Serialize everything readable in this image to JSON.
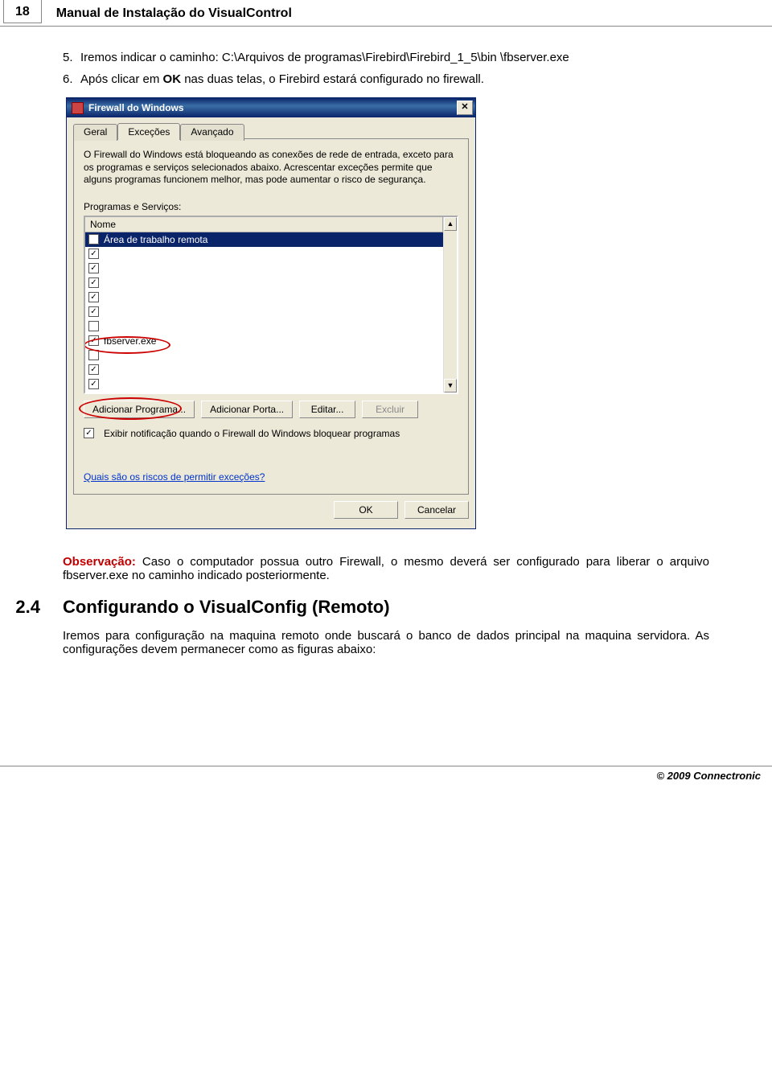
{
  "header": {
    "page_number": "18",
    "title": "Manual de Instalação do VisualControl"
  },
  "steps": [
    {
      "num": "5.",
      "text_a": "Iremos indicar o caminho: C:\\Arquivos de programas\\Firebird\\Firebird_1_5\\bin \\fbserver.exe"
    },
    {
      "num": "6.",
      "text_a": "Após clicar em ",
      "bold": "OK",
      "text_b": " nas duas telas, o Firebird estará configurado no firewall."
    }
  ],
  "dialog": {
    "title": "Firewall do Windows",
    "tabs": {
      "general": "Geral",
      "exceptions": "Exceções",
      "advanced": "Avançado"
    },
    "description": "O Firewall do Windows está bloqueando as conexões de rede de entrada, exceto para os programas e serviços selecionados abaixo. Acrescentar exceções permite que alguns programas funcionem melhor, mas pode aumentar o risco de segurança.",
    "list_label": "Programas e Serviços:",
    "list_header": "Nome",
    "items": [
      {
        "checked": false,
        "label": "Área de trabalho remota",
        "selected": true
      },
      {
        "checked": true,
        "label": ""
      },
      {
        "checked": true,
        "label": ""
      },
      {
        "checked": true,
        "label": ""
      },
      {
        "checked": true,
        "label": ""
      },
      {
        "checked": true,
        "label": ""
      },
      {
        "checked": false,
        "label": ""
      },
      {
        "checked": true,
        "label": "fbserver.exe"
      },
      {
        "checked": false,
        "label": ""
      },
      {
        "checked": true,
        "label": ""
      },
      {
        "checked": true,
        "label": ""
      }
    ],
    "buttons": {
      "add_program": "Adicionar Programa...",
      "add_port": "Adicionar Porta...",
      "edit": "Editar...",
      "delete": "Excluir"
    },
    "notify": "Exibir notificação quando o Firewall do Windows bloquear programas",
    "risks_link": "Quais são os riscos de permitir exceções?",
    "ok": "OK",
    "cancel": "Cancelar"
  },
  "observation": {
    "label": "Observação:",
    "text": " Caso o computador possua outro Firewall, o mesmo deverá ser configurado para liberar o arquivo fbserver.exe no caminho indicado posteriormente."
  },
  "section": {
    "num": "2.4",
    "title": "Configurando o VisualConfig (Remoto)",
    "para": "Iremos para configuração na maquina remoto onde buscará o banco de dados principal na maquina servidora. As configurações devem permanecer como as figuras abaixo:"
  },
  "footer": "© 2009 Connectronic"
}
